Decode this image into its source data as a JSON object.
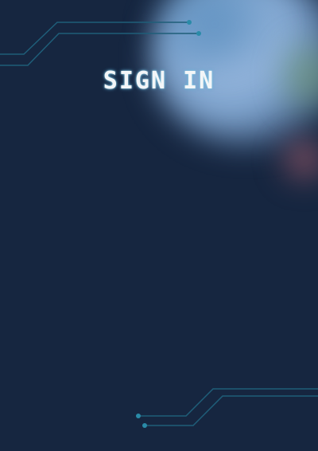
{
  "page": {
    "title": "SIGN IN"
  },
  "theme": {
    "background": "#162640",
    "circuit_line": "#1f5e79",
    "circuit_node": "#2a8ba8",
    "title_color": "#f3f6f8"
  },
  "decorations": {
    "top_left": "circuit-traces",
    "bottom_right": "circuit-traces",
    "top_right": "blurred-color-glow"
  }
}
